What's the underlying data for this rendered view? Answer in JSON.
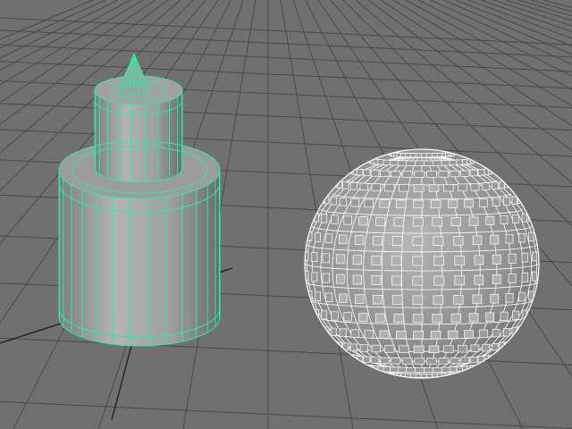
{
  "viewport": {
    "view": "perspective",
    "background_color": "#707070",
    "grid_color": "#4a4a4a",
    "grid_axis_color": "#2a2a2a",
    "objects": [
      {
        "name": "stacked-cylinder-with-cone",
        "state": "selected",
        "display": "shaded-with-wireframe",
        "wire_color": "#2ee8a4",
        "shade_color": "#a8a8a8"
      },
      {
        "name": "sphere-with-extruded-faces",
        "state": "unselected",
        "display": "wireframe-on-shaded",
        "wire_color": "#ffffff",
        "shade_color": "#9a9a9a"
      }
    ]
  }
}
